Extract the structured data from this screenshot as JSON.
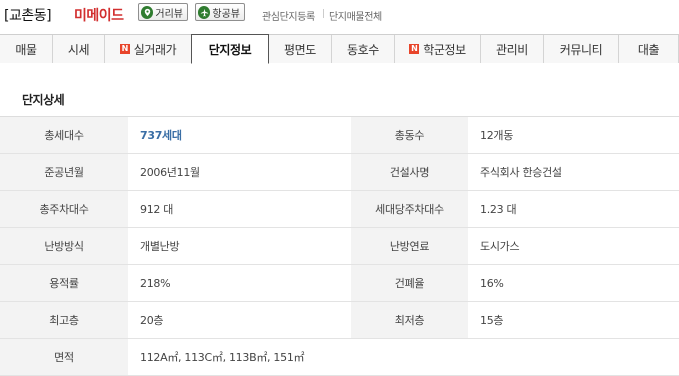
{
  "header": {
    "dong": "[교촌동]",
    "apartment": "미메이드",
    "street_view_label": "거리뷰",
    "aerial_view_label": "항공뷰",
    "register_link": "관심단지등록",
    "all_listings_link": "단지매물전체"
  },
  "tabs": [
    {
      "label": "매물",
      "badge": ""
    },
    {
      "label": "시세",
      "badge": ""
    },
    {
      "label": "실거래가",
      "badge": "N"
    },
    {
      "label": "단지정보",
      "badge": ""
    },
    {
      "label": "평면도",
      "badge": ""
    },
    {
      "label": "동호수",
      "badge": ""
    },
    {
      "label": "학군정보",
      "badge": "N"
    },
    {
      "label": "관리비",
      "badge": ""
    },
    {
      "label": "커뮤니티",
      "badge": ""
    },
    {
      "label": "대출",
      "badge": ""
    }
  ],
  "active_tab": "단지정보",
  "section_title": "단지상세",
  "rows": [
    {
      "l1": "총세대수",
      "v1": "737세대",
      "l2": "총동수",
      "v2": "12개동"
    },
    {
      "l1": "준공년월",
      "v1": "2006년11월",
      "l2": "건설사명",
      "v2": "주식회사 한승건설"
    },
    {
      "l1": "총주차대수",
      "v1": "912 대",
      "l2": "세대당주차대수",
      "v2": "1.23 대"
    },
    {
      "l1": "난방방식",
      "v1": "개별난방",
      "l2": "난방연료",
      "v2": "도시가스"
    },
    {
      "l1": "용적률",
      "v1": "218%",
      "l2": "건폐율",
      "v2": "16%"
    },
    {
      "l1": "최고층",
      "v1": "20층",
      "l2": "최저층",
      "v2": "15층"
    }
  ],
  "area": {
    "label": "면적",
    "value": "112A㎡, 113C㎡, 113B㎡, 151㎡"
  },
  "colors": {
    "accent": "#d22f2f",
    "link": "#3a6ea5",
    "badge": "#e8452b",
    "label_bg": "#f3f3f3"
  }
}
